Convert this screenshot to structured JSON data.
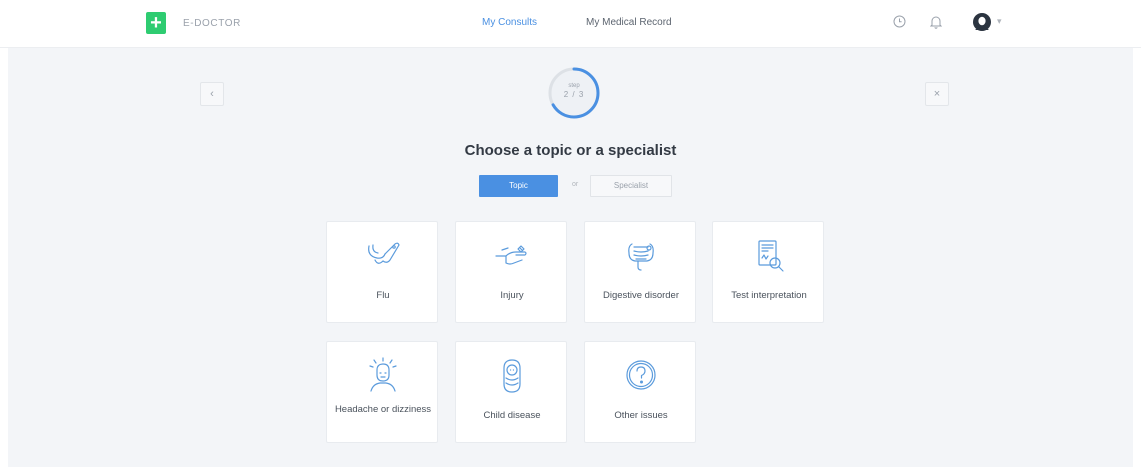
{
  "header": {
    "brand": "E-DOCTOR",
    "logo_symbol": "+",
    "nav": [
      {
        "label": "My Consults",
        "active": true
      },
      {
        "label": "My Medical Record",
        "active": false
      }
    ],
    "icons": [
      "clock-icon",
      "bell-icon",
      "user-avatar-icon"
    ],
    "avatar_caret": "▾"
  },
  "wizard": {
    "back_symbol": "‹",
    "close_symbol": "×",
    "progress": {
      "step_label": "step",
      "count": "2 / 3",
      "fraction": 0.6667
    },
    "title": "Choose a topic or a specialist",
    "toggle": {
      "topic": "Topic",
      "or": "or",
      "specialist": "Specialist",
      "selected": "Topic"
    }
  },
  "topics": [
    {
      "label": "Flu",
      "icon": "flu-icon"
    },
    {
      "label": "Injury",
      "icon": "injury-icon"
    },
    {
      "label": "Digestive disorder",
      "icon": "digestive-icon"
    },
    {
      "label": "Test interpretation",
      "icon": "test-report-icon"
    },
    {
      "label": "Headache or dizziness",
      "icon": "headache-icon"
    },
    {
      "label": "Child disease",
      "icon": "baby-icon"
    },
    {
      "label": "Other issues",
      "icon": "question-icon"
    }
  ],
  "colors": {
    "accent": "#4a90e2",
    "brand": "#2ecc71",
    "background": "#f3f5f8",
    "icon_blue": "#5b9bdc"
  }
}
